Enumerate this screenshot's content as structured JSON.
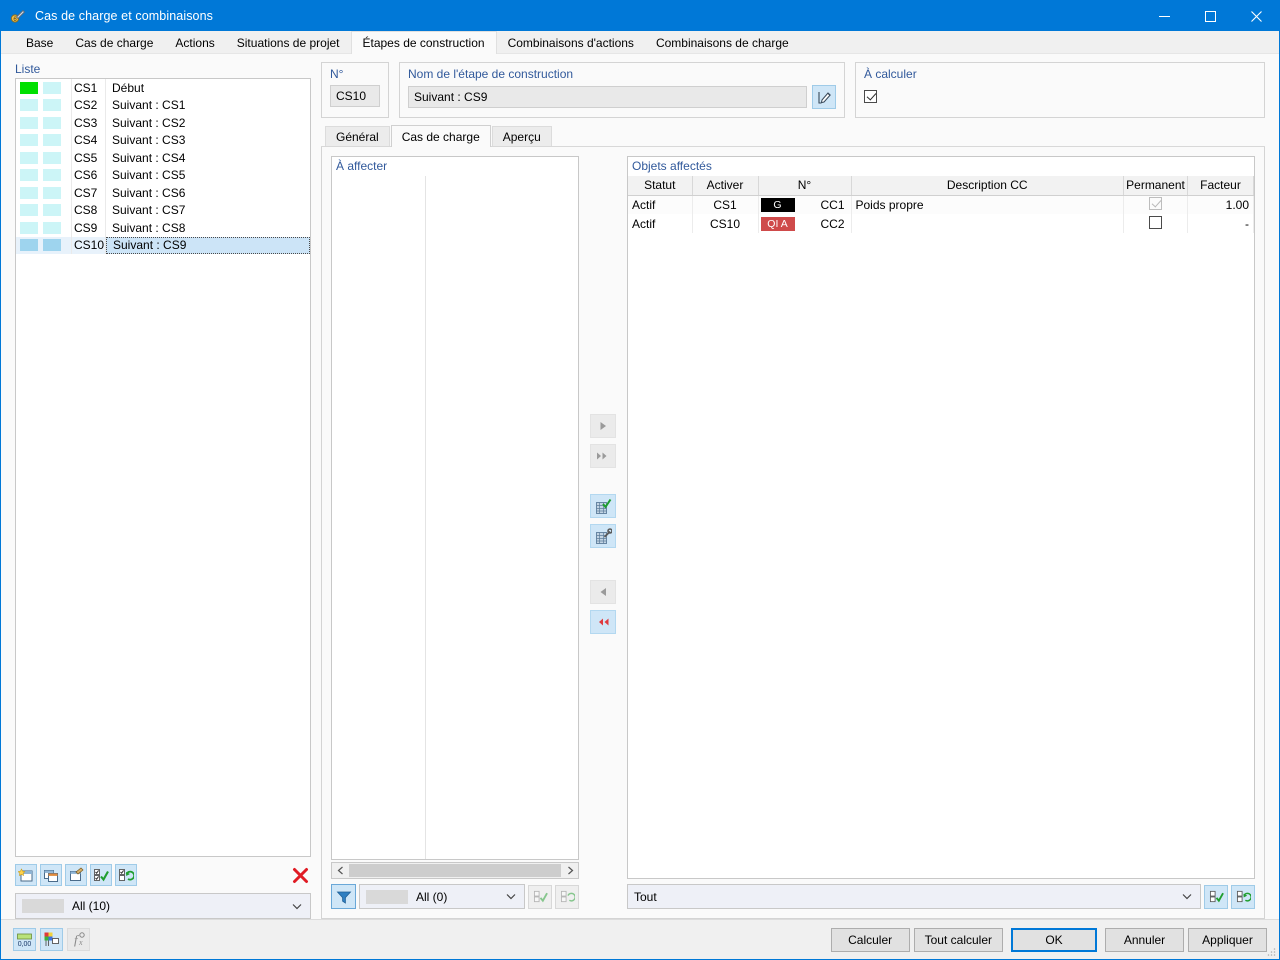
{
  "window": {
    "title": "Cas de charge et combinaisons",
    "app_icon": "load-case-icon",
    "controls": {
      "minimize": "–",
      "maximize": "☐",
      "close": "✕"
    }
  },
  "tabs": [
    {
      "label": "Base",
      "active": false
    },
    {
      "label": "Cas de charge",
      "active": false
    },
    {
      "label": "Actions",
      "active": false
    },
    {
      "label": "Situations de projet",
      "active": false
    },
    {
      "label": "Étapes de construction",
      "active": true
    },
    {
      "label": "Combinaisons d'actions",
      "active": false
    },
    {
      "label": "Combinaisons de charge",
      "active": false
    }
  ],
  "list_panel": {
    "label": "Liste",
    "rows": [
      {
        "color": "#00e000",
        "no": "CS1",
        "name": "Début",
        "selected": false
      },
      {
        "color": "#ccf5f7",
        "no": "CS2",
        "name": "Suivant : CS1",
        "selected": false
      },
      {
        "color": "#ccf5f7",
        "no": "CS3",
        "name": "Suivant : CS2",
        "selected": false
      },
      {
        "color": "#ccf5f7",
        "no": "CS4",
        "name": "Suivant : CS3",
        "selected": false
      },
      {
        "color": "#ccf5f7",
        "no": "CS5",
        "name": "Suivant : CS4",
        "selected": false
      },
      {
        "color": "#ccf5f7",
        "no": "CS6",
        "name": "Suivant : CS5",
        "selected": false
      },
      {
        "color": "#ccf5f7",
        "no": "CS7",
        "name": "Suivant : CS6",
        "selected": false
      },
      {
        "color": "#ccf5f7",
        "no": "CS8",
        "name": "Suivant : CS7",
        "selected": false
      },
      {
        "color": "#ccf5f7",
        "no": "CS9",
        "name": "Suivant : CS8",
        "selected": false
      },
      {
        "color": "#9ed4ee",
        "no": "CS10",
        "name": "Suivant : CS9",
        "selected": true
      }
    ],
    "toolbar": [
      {
        "name": "new-construction-stage-button"
      },
      {
        "name": "copy-construction-stage-button"
      },
      {
        "name": "edit-construction-stage-button"
      },
      {
        "name": "select-all-button"
      },
      {
        "name": "invert-selection-button"
      },
      {
        "name": "delete-construction-stage-button"
      }
    ],
    "filter_combo": {
      "value": "All (10)",
      "chip_color": "#d9d9d9"
    }
  },
  "header_fields": {
    "no": {
      "label": "N°",
      "value": "CS10"
    },
    "name": {
      "label": "Nom de l'étape de construction",
      "value": "Suivant : CS9",
      "edit_icon": "edit-pencil-icon"
    },
    "calculate": {
      "label": "À calculer",
      "checked": true
    }
  },
  "inner_tabs": [
    {
      "label": "Général",
      "active": false
    },
    {
      "label": "Cas de charge",
      "active": true
    },
    {
      "label": "Aperçu",
      "active": false
    }
  ],
  "assign_panel": {
    "title": "À affecter",
    "rows": [],
    "filter_combo": {
      "value": "All (0)",
      "chip_color": "#d9d9d9"
    },
    "filter_icon": "funnel-filter-icon",
    "buttons": [
      {
        "name": "assign-select-all-button"
      },
      {
        "name": "assign-invert-selection-button"
      }
    ]
  },
  "transfer_buttons": [
    {
      "name": "move-right-button",
      "glyph": "▶",
      "style": "grey"
    },
    {
      "name": "move-all-right-button",
      "glyph": "▶▶",
      "style": "grey"
    },
    {
      "name": "structure-check-button",
      "glyph": "structure-check-icon",
      "style": "blue"
    },
    {
      "name": "structure-tools-button",
      "glyph": "structure-tools-icon",
      "style": "blue"
    },
    {
      "name": "move-left-button",
      "glyph": "◀",
      "style": "grey"
    },
    {
      "name": "move-all-left-button",
      "glyph": "◀◀",
      "style": "red"
    }
  ],
  "objects_panel": {
    "title": "Objets affectés",
    "columns": [
      "Statut",
      "Activer",
      "N°",
      "Description CC",
      "Permanent",
      "Facteur"
    ],
    "rows": [
      {
        "statut": "Actif",
        "activer": "CS1",
        "badge": {
          "text": "G",
          "type": "g"
        },
        "no": "CC1",
        "description": "Poids propre",
        "permanent": {
          "checked": true,
          "disabled": true
        },
        "facteur": "1.00"
      },
      {
        "statut": "Actif",
        "activer": "CS10",
        "badge": {
          "text": "QI A",
          "type": "q"
        },
        "no": "CC2",
        "description": "",
        "permanent": {
          "checked": false,
          "disabled": false
        },
        "facteur": "-"
      }
    ],
    "filter_combo": {
      "value": "Tout"
    },
    "buttons": [
      {
        "name": "objects-select-all-button"
      },
      {
        "name": "objects-invert-selection-button"
      }
    ]
  },
  "footer": {
    "left_icons": [
      {
        "name": "decimal-places-icon",
        "label": "0.00"
      },
      {
        "name": "color-legend-icon"
      },
      {
        "name": "formula-function-icon"
      }
    ],
    "buttons": [
      {
        "label": "Calculer",
        "primary": false
      },
      {
        "label": "Tout calculer",
        "primary": false
      },
      {
        "label": "OK",
        "primary": true
      },
      {
        "label": "Annuler",
        "primary": false
      },
      {
        "label": "Appliquer",
        "primary": false
      }
    ]
  },
  "colors": {
    "titlebar": "#0078d7",
    "accent": "#0078d7",
    "group_label": "#31599b",
    "selection": "#cce4f7",
    "badge_permanent": "#000000",
    "badge_variable": "#cf4a4a",
    "start_stage": "#00e000"
  }
}
